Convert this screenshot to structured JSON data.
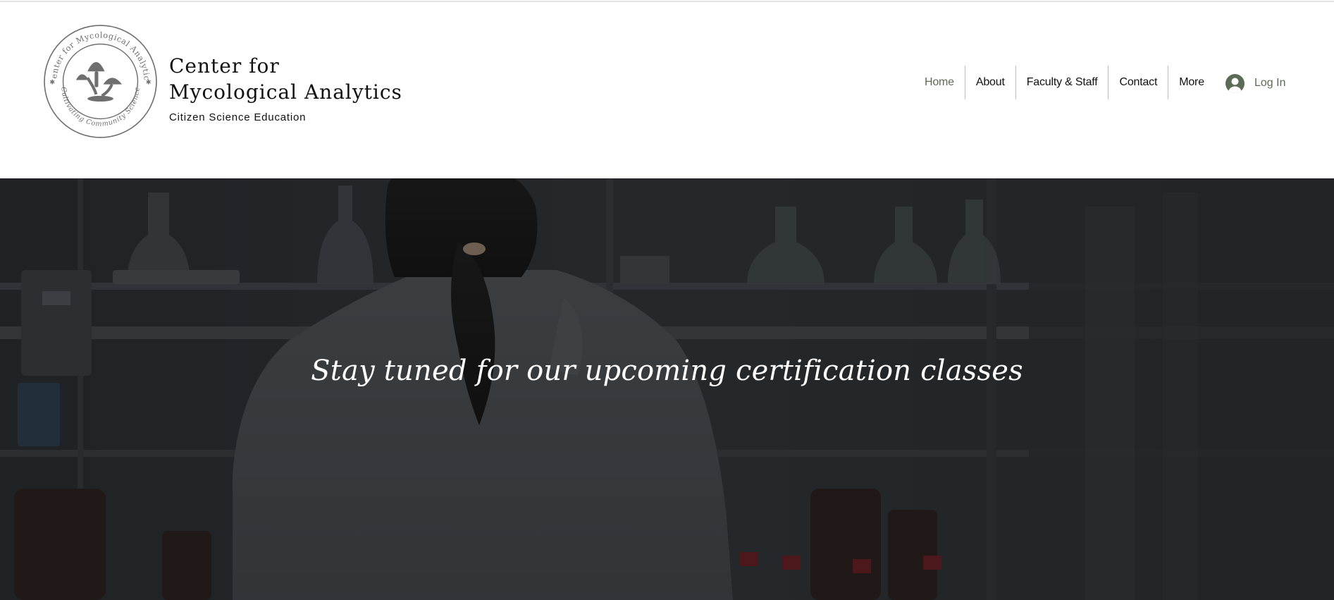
{
  "header": {
    "seal": {
      "top_text": "Center for Mycological Analytics",
      "bottom_text": "Cultivating Community Science"
    },
    "brand": {
      "title_line1": "Center for",
      "title_line2": "Mycological Analytics",
      "tagline": "Citizen Science Education"
    },
    "nav": {
      "items": [
        {
          "label": "Home",
          "active": true
        },
        {
          "label": "About"
        },
        {
          "label": "Faculty & Staff"
        },
        {
          "label": "Contact"
        },
        {
          "label": "More"
        }
      ]
    },
    "login": {
      "label": "Log In",
      "icon": "user-avatar-icon"
    }
  },
  "hero": {
    "heading": "Stay tuned for our upcoming certification classes"
  },
  "colors": {
    "accent": "#5c6b55",
    "text": "#111111",
    "nav_separator": "#bdbdbd",
    "hero_text": "#ffffff"
  }
}
